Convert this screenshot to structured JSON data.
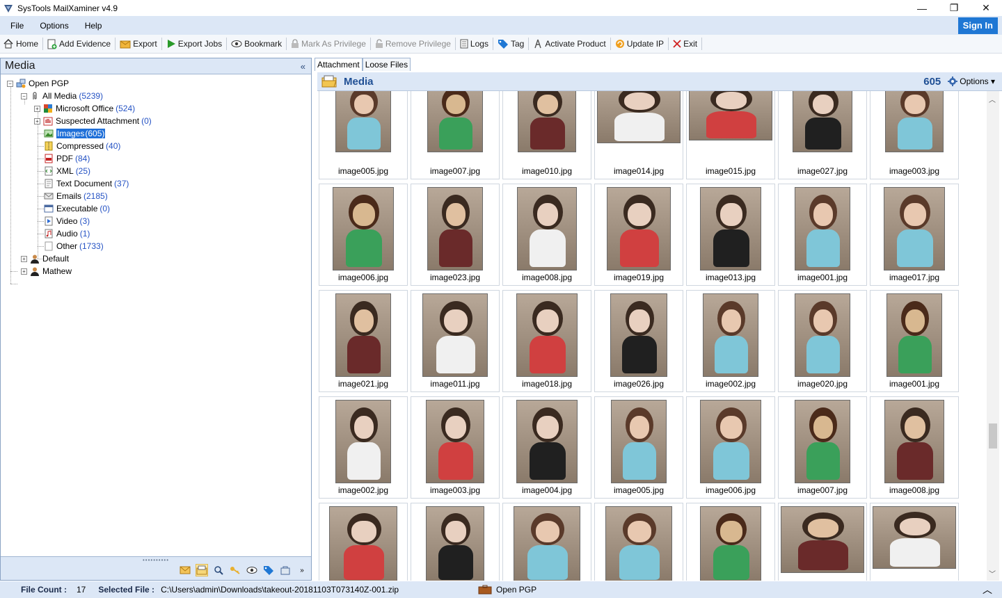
{
  "window": {
    "title": "SysTools MailXaminer v4.9",
    "minimize": "—",
    "maximize": "❐",
    "close": "✕"
  },
  "menu": {
    "items": [
      "File",
      "Options",
      "Help"
    ],
    "signin": "Sign In"
  },
  "toolbar": {
    "home": "Home",
    "add_evidence": "Add Evidence",
    "export": "Export",
    "export_jobs": "Export Jobs",
    "bookmark": "Bookmark",
    "mark_privilege": "Mark As Privilege",
    "remove_privilege": "Remove Privilege",
    "logs": "Logs",
    "tag": "Tag",
    "activate": "Activate Product",
    "update_ip": "Update IP",
    "exit": "Exit"
  },
  "left_panel": {
    "title": "Media",
    "collapse": "«",
    "tree": [
      {
        "label": "Open PGP",
        "count": ""
      },
      {
        "label": "All Media",
        "count": "(5239)"
      },
      {
        "label": "Microsoft Office",
        "count": "(524)"
      },
      {
        "label": "Suspected Attachment",
        "count": "(0)"
      },
      {
        "label": "Images",
        "count": "(605)"
      },
      {
        "label": "Compressed",
        "count": "(40)"
      },
      {
        "label": "PDF",
        "count": "(84)"
      },
      {
        "label": "XML",
        "count": "(25)"
      },
      {
        "label": "Text Document",
        "count": "(37)"
      },
      {
        "label": "Emails",
        "count": "(2185)"
      },
      {
        "label": "Executable",
        "count": "(0)"
      },
      {
        "label": "Video",
        "count": "(3)"
      },
      {
        "label": "Audio",
        "count": "(1)"
      },
      {
        "label": "Other",
        "count": "(1733)"
      },
      {
        "label": "Default",
        "count": ""
      },
      {
        "label": "Mathew",
        "count": ""
      }
    ]
  },
  "right_panel": {
    "tabs": [
      "Attachment",
      "Loose Files"
    ],
    "media_title": "Media",
    "media_count": "605",
    "options_label": "Options ▾",
    "gallery": [
      [
        "image005.jpg",
        "image007.jpg",
        "image010.jpg",
        "image014.jpg",
        "image015.jpg",
        "image027.jpg",
        "image003.jpg"
      ],
      [
        "image006.jpg",
        "image023.jpg",
        "image008.jpg",
        "image019.jpg",
        "image013.jpg",
        "image001.jpg",
        "image017.jpg"
      ],
      [
        "image021.jpg",
        "image011.jpg",
        "image018.jpg",
        "image026.jpg",
        "image002.jpg",
        "image020.jpg",
        "image001.jpg"
      ],
      [
        "image002.jpg",
        "image003.jpg",
        "image004.jpg",
        "image005.jpg",
        "image006.jpg",
        "image007.jpg",
        "image008.jpg"
      ],
      [
        "",
        "",
        "",
        "",
        "",
        "",
        ""
      ]
    ]
  },
  "status": {
    "file_count_label": "File Count :",
    "file_count": "17",
    "selected_label": "Selected File :",
    "selected_path": "C:\\Users\\admin\\Downloads\\takeout-20181103T073140Z-001.zip",
    "source": "Open PGP",
    "chevron": "︿"
  }
}
